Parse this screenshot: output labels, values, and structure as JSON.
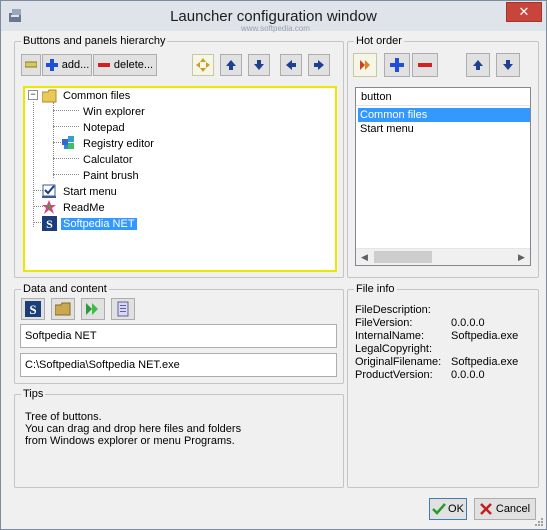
{
  "window": {
    "title": "Launcher configuration window",
    "watermark": "www.softpedia.com",
    "close_label": "✕"
  },
  "hierarchy": {
    "legend": "Buttons and panels hierarchy",
    "add_label": "add...",
    "delete_label": "delete...",
    "tree": [
      {
        "label": "Common files",
        "expander": "−",
        "icon": "folder-icon"
      },
      {
        "label": "Win explorer"
      },
      {
        "label": "Notepad"
      },
      {
        "label": "Registry editor",
        "icon": "registry-icon"
      },
      {
        "label": "Calculator"
      },
      {
        "label": "Paint brush"
      },
      {
        "label": "Start menu",
        "icon": "checkbox-icon"
      },
      {
        "label": "ReadMe",
        "icon": "star-icon"
      },
      {
        "label": "Softpedia NET",
        "icon": "softpedia-icon",
        "selected": true
      }
    ]
  },
  "hot_order": {
    "legend": "Hot order",
    "column_header": "button",
    "items": [
      {
        "label": "Common files",
        "selected": true
      },
      {
        "label": "Start menu",
        "selected": false
      }
    ]
  },
  "data_content": {
    "legend": "Data and content",
    "name_value": "Softpedia NET",
    "path_value": "C:\\Softpedia\\Softpedia NET.exe"
  },
  "tips": {
    "legend": "Tips",
    "lines": [
      "Tree of buttons.",
      "You can drag and drop here files and folders",
      "from Windows explorer or menu Programs."
    ]
  },
  "file_info": {
    "legend": "File info",
    "rows": [
      {
        "key": "FileDescription:",
        "value": ""
      },
      {
        "key": "FileVersion:",
        "value": "0.0.0.0"
      },
      {
        "key": "InternalName:",
        "value": "Softpedia.exe"
      },
      {
        "key": "LegalCopyright:",
        "value": ""
      },
      {
        "key": "OriginalFilename:",
        "value": "Softpedia.exe"
      },
      {
        "key": "ProductVersion:",
        "value": "0.0.0.0"
      }
    ]
  },
  "footer": {
    "ok_label": "OK",
    "cancel_label": "Cancel"
  },
  "colors": {
    "selection": "#3399ff",
    "tree_border": "#e8e800",
    "add_blue": "#1f4fd8",
    "delete_red": "#d42020"
  }
}
